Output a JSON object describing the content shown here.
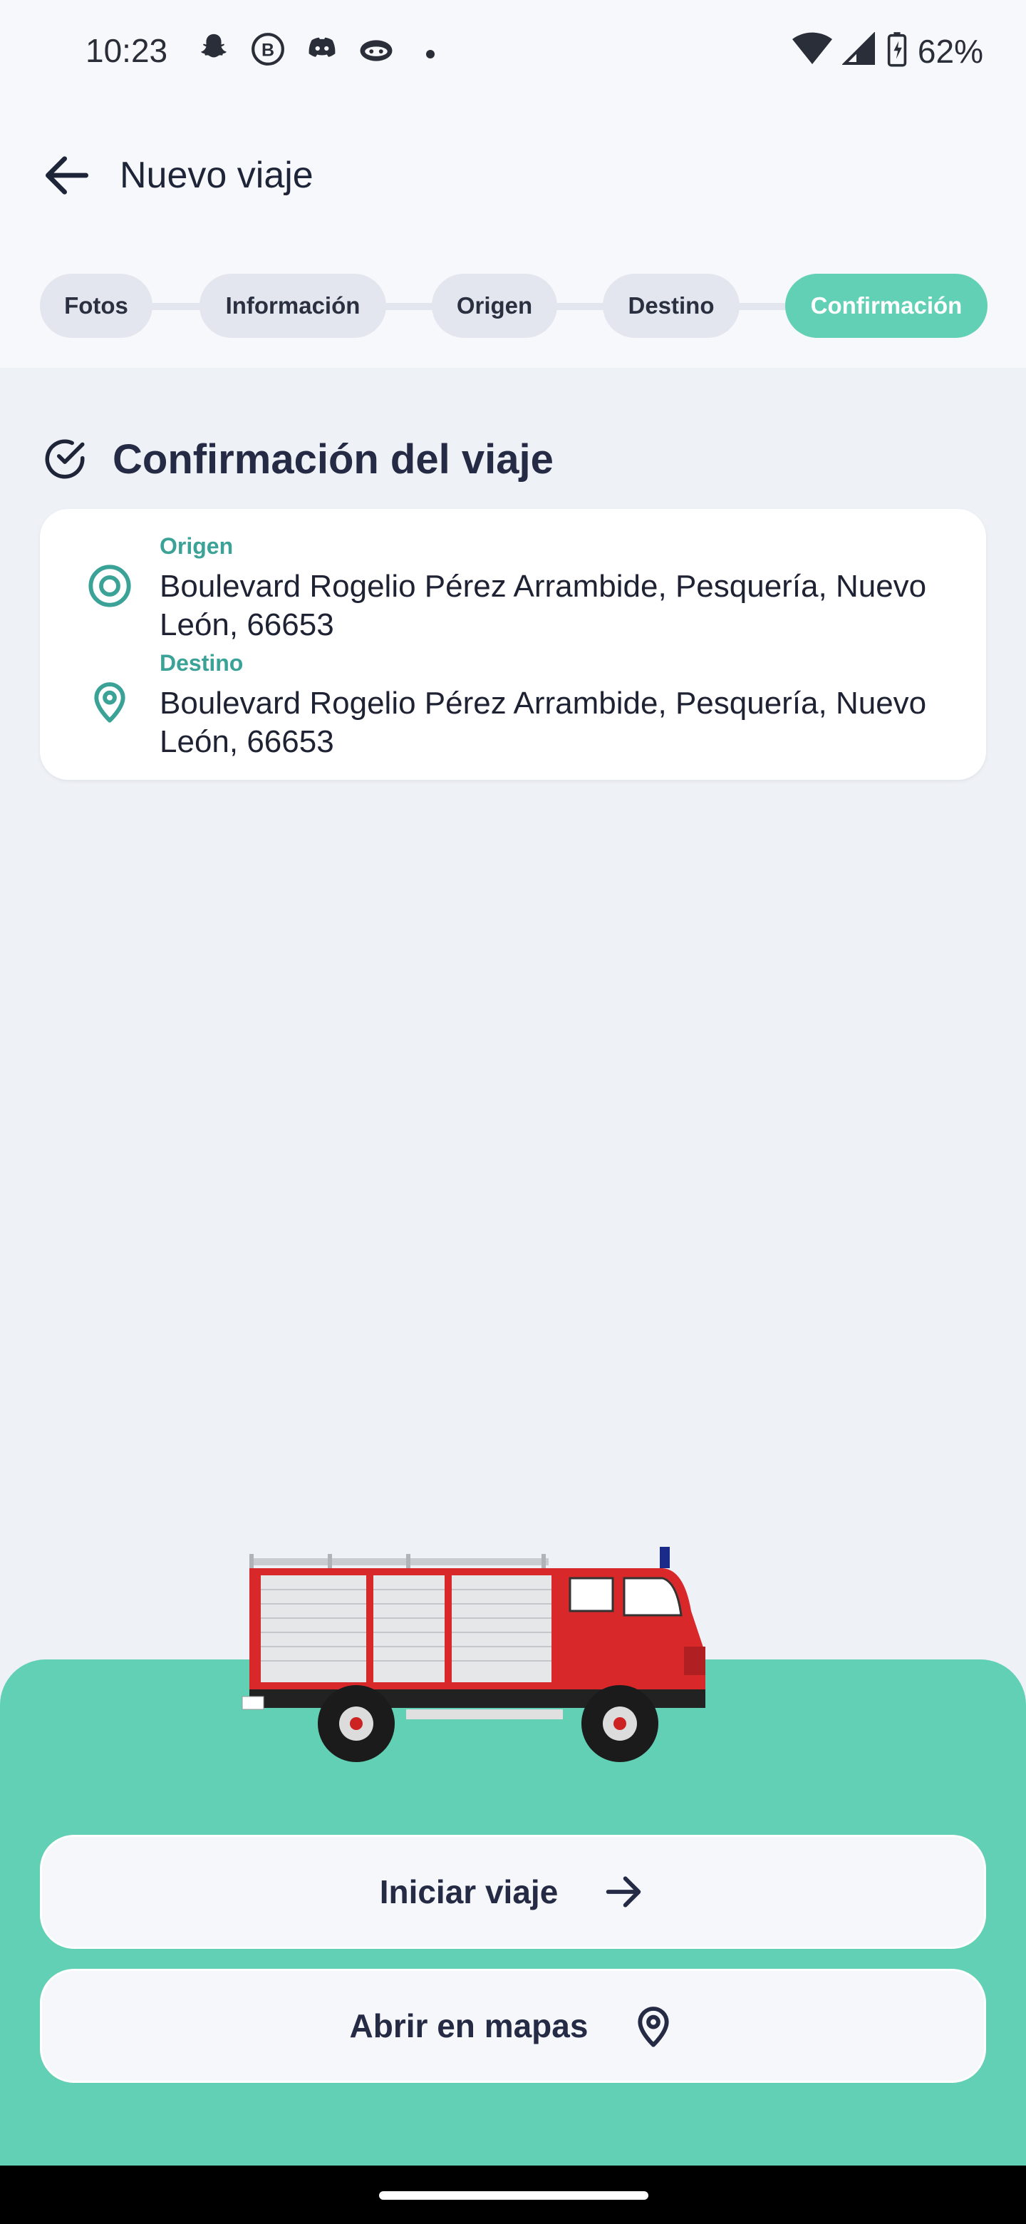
{
  "status_bar": {
    "time": "10:23",
    "battery": "62%",
    "icons": [
      "snapchat-icon",
      "b-icon",
      "discord-icon",
      "cat-icon",
      "dot-icon",
      "wifi-icon",
      "signal-icon",
      "battery-charging-icon"
    ]
  },
  "header": {
    "title": "Nuevo viaje",
    "back_icon": "arrow-left-icon"
  },
  "stepper": {
    "steps": [
      "Fotos",
      "Información",
      "Origen",
      "Destino",
      "Confirmación"
    ],
    "active_step": "Confirmación"
  },
  "confirmation": {
    "title": "Confirmación del viaje",
    "origin": {
      "label": "Origen",
      "address": "Boulevard Rogelio Pérez Arrambide, Pesquería, Nuevo León, 66653"
    },
    "destination": {
      "label": "Destino",
      "address": "Boulevard Rogelio Pérez Arrambide, Pesquería, Nuevo León, 66653"
    }
  },
  "actions": {
    "start_trip": "Iniciar viaje",
    "open_maps": "Abrir en mapas"
  },
  "colors": {
    "accent": "#62d0b5",
    "label_teal": "#3aa296",
    "background": "#eef1f6"
  }
}
